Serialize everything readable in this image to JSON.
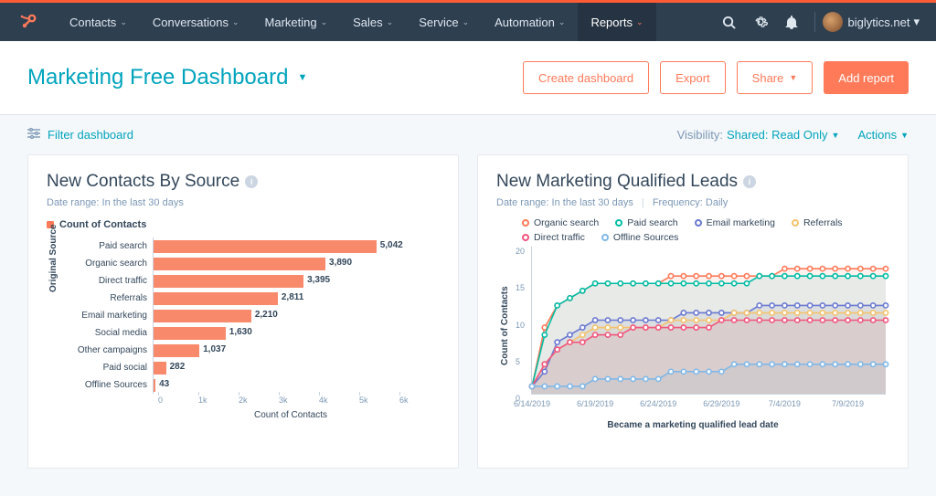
{
  "nav": {
    "items": [
      "Contacts",
      "Conversations",
      "Marketing",
      "Sales",
      "Service",
      "Automation",
      "Reports"
    ],
    "active": "Reports",
    "account": "biglytics.net"
  },
  "header": {
    "title": "Marketing Free Dashboard",
    "buttons": {
      "create": "Create dashboard",
      "export": "Export",
      "share": "Share",
      "add": "Add report"
    }
  },
  "toolbar": {
    "filter": "Filter dashboard",
    "visibility_label": "Visibility:",
    "visibility_value": "Shared: Read Only",
    "actions": "Actions"
  },
  "card1": {
    "title": "New Contacts By Source",
    "date_label": "Date range:",
    "date_value": "In the last 30 days",
    "legend": "Count of Contacts",
    "ylabel": "Original Source",
    "xlabel": "Count of Contacts"
  },
  "card2": {
    "title": "New Marketing Qualified Leads",
    "date_label": "Date range:",
    "date_value": "In the last 30 days",
    "freq_label": "Frequency:",
    "freq_value": "Daily",
    "ylabel": "Count of Contacts",
    "xlabel": "Became a marketing qualified lead date"
  },
  "chart_data": [
    {
      "type": "bar",
      "title": "New Contacts By Source",
      "ylabel": "Original Source",
      "xlabel": "Count of Contacts",
      "xlim": [
        0,
        6000
      ],
      "xticks": [
        "0",
        "1k",
        "2k",
        "3k",
        "4k",
        "5k",
        "6k"
      ],
      "categories": [
        "Paid search",
        "Organic search",
        "Direct traffic",
        "Referrals",
        "Email marketing",
        "Social media",
        "Other campaigns",
        "Paid social",
        "Offline Sources"
      ],
      "values": [
        5042,
        3890,
        3395,
        2811,
        2210,
        1630,
        1037,
        282,
        43
      ],
      "color": "#f9896b"
    },
    {
      "type": "line",
      "title": "New Marketing Qualified Leads",
      "ylabel": "Count of Contacts",
      "xlabel": "Became a marketing qualified lead date",
      "ylim": [
        0,
        20
      ],
      "yticks": [
        0,
        5,
        10,
        15,
        20
      ],
      "x": [
        "6/14/2019",
        "6/15",
        "6/16",
        "6/17",
        "6/18",
        "6/19/2019",
        "6/20",
        "6/21",
        "6/22",
        "6/23",
        "6/24/2019",
        "6/25",
        "6/26",
        "6/27",
        "6/28",
        "6/29/2019",
        "6/30",
        "7/1",
        "7/2",
        "7/3",
        "7/4/2019",
        "7/5",
        "7/6",
        "7/7",
        "7/8",
        "7/9/2019",
        "7/10",
        "7/11",
        "7/12"
      ],
      "xticks_idx": [
        0,
        5,
        10,
        15,
        20,
        25
      ],
      "series": [
        {
          "name": "Organic search",
          "color": "#ff7a59",
          "values": [
            1,
            9,
            12,
            13,
            14,
            15,
            15,
            15,
            15,
            15,
            15,
            16,
            16,
            16,
            16,
            16,
            16,
            16,
            16,
            16,
            17,
            17,
            17,
            17,
            17,
            17,
            17,
            17,
            17
          ]
        },
        {
          "name": "Paid search",
          "color": "#00bda5",
          "values": [
            1,
            8,
            12,
            13,
            14,
            15,
            15,
            15,
            15,
            15,
            15,
            15,
            15,
            15,
            15,
            15,
            15,
            15,
            16,
            16,
            16,
            16,
            16,
            16,
            16,
            16,
            16,
            16,
            16
          ]
        },
        {
          "name": "Email marketing",
          "color": "#6a78d1",
          "values": [
            1,
            3,
            7,
            8,
            9,
            10,
            10,
            10,
            10,
            10,
            10,
            10,
            11,
            11,
            11,
            11,
            11,
            11,
            12,
            12,
            12,
            12,
            12,
            12,
            12,
            12,
            12,
            12,
            12
          ]
        },
        {
          "name": "Referrals",
          "color": "#f5c26b",
          "values": [
            1,
            4,
            6,
            7,
            8,
            9,
            9,
            9,
            9,
            9,
            9,
            10,
            10,
            10,
            10,
            10,
            11,
            11,
            11,
            11,
            11,
            11,
            11,
            11,
            11,
            11,
            11,
            11,
            11
          ]
        },
        {
          "name": "Direct traffic",
          "color": "#f2547d",
          "values": [
            1,
            4,
            6,
            7,
            7,
            8,
            8,
            8,
            9,
            9,
            9,
            9,
            9,
            9,
            9,
            10,
            10,
            10,
            10,
            10,
            10,
            10,
            10,
            10,
            10,
            10,
            10,
            10,
            10
          ]
        },
        {
          "name": "Offline Sources",
          "color": "#7fb7e8",
          "values": [
            1,
            1,
            1,
            1,
            1,
            2,
            2,
            2,
            2,
            2,
            2,
            3,
            3,
            3,
            3,
            3,
            4,
            4,
            4,
            4,
            4,
            4,
            4,
            4,
            4,
            4,
            4,
            4,
            4
          ]
        }
      ],
      "legend_order": [
        "Organic search",
        "Paid search",
        "Email marketing",
        "Referrals",
        "Direct traffic",
        "Offline Sources"
      ]
    }
  ]
}
